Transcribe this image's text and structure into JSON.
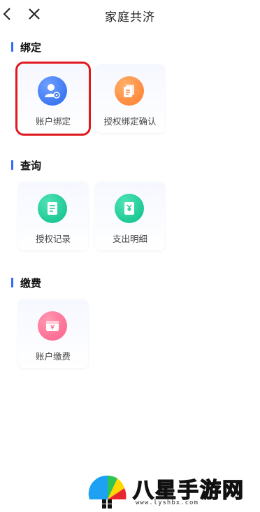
{
  "header": {
    "title": "家庭共济"
  },
  "sections": [
    {
      "title": "绑定",
      "tiles": [
        {
          "label": "账户绑定",
          "icon": "user-settings-icon"
        },
        {
          "label": "授权绑定确认",
          "icon": "documents-icon"
        }
      ]
    },
    {
      "title": "查询",
      "tiles": [
        {
          "label": "授权记录",
          "icon": "list-icon"
        },
        {
          "label": "支出明细",
          "icon": "yuan-document-icon"
        }
      ]
    },
    {
      "title": "缴费",
      "tiles": [
        {
          "label": "账户缴费",
          "icon": "yuan-wallet-icon"
        }
      ]
    }
  ],
  "watermark": {
    "text": "八星手游网",
    "url": "www.lyshbx.com"
  },
  "colors": {
    "accent": "#2f6bff",
    "highlight": "#e0191f",
    "blue": "#4a80f5",
    "orange": "#ff8a3d",
    "green": "#1fc996",
    "pink": "#ff6f95"
  }
}
